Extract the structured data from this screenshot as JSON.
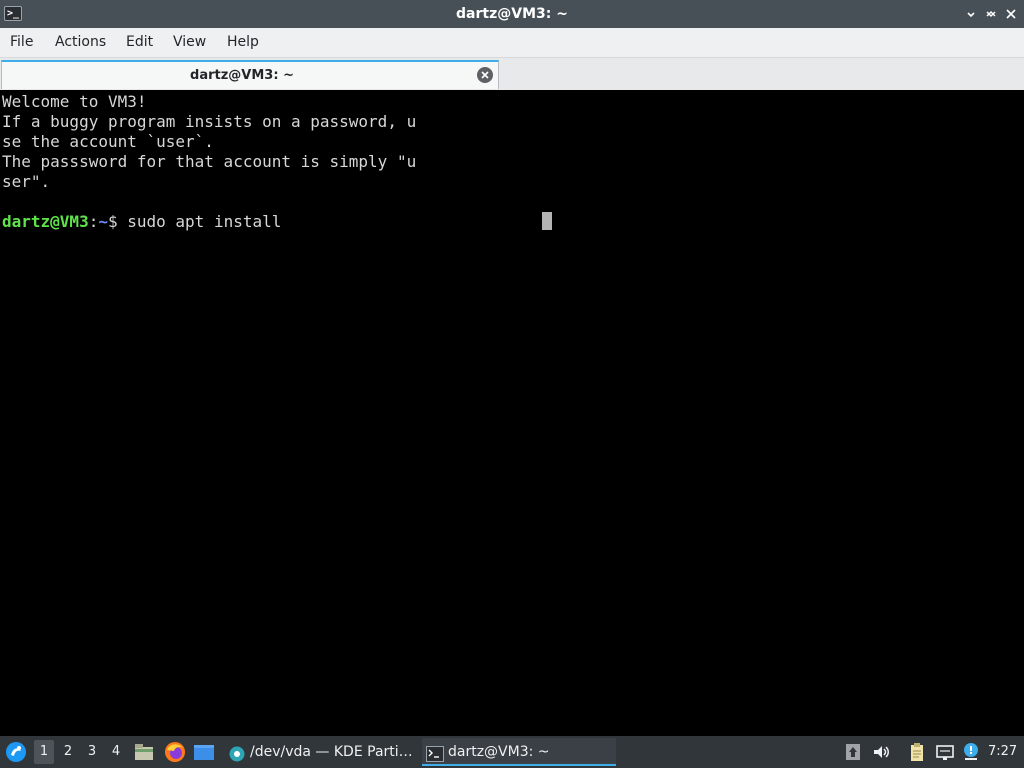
{
  "window": {
    "title": "dartz@VM3: ~",
    "app_icon": "terminal-icon",
    "controls": [
      "minimize-icon",
      "maximize-icon",
      "close-icon"
    ]
  },
  "menu": {
    "items": [
      "File",
      "Actions",
      "Edit",
      "View",
      "Help"
    ]
  },
  "tabs": [
    {
      "label": "dartz@VM3: ~",
      "active": true
    }
  ],
  "terminal": {
    "lines": [
      "Welcome to VM3!",
      "If a buggy program insists on a password, u",
      "se the account `user`.",
      "The passsword for that account is simply \"u",
      "ser\".",
      ""
    ],
    "prompt": {
      "user_host": "dartz@VM3",
      "separator": ":",
      "path": "~",
      "symbol": "$ ",
      "command": "sudo apt install"
    }
  },
  "taskbar": {
    "desktops": [
      "1",
      "2",
      "3",
      "4"
    ],
    "active_desktop": "1",
    "launchers": [
      "start-menu-icon",
      "file-manager-icon",
      "firefox-icon",
      "show-desktop-icon"
    ],
    "tasks": [
      {
        "label": "/dev/vda — KDE Parti…",
        "icon": "kde-partition-manager-icon"
      },
      {
        "label": "dartz@VM3: ~",
        "icon": "terminal-icon"
      }
    ],
    "tray": [
      "updates-icon",
      "volume-icon",
      "clipboard-icon",
      "network-icon",
      "notifications-icon"
    ],
    "clock": "7:27"
  },
  "colors": {
    "titlebar": "#475057",
    "menubar": "#eff0f1",
    "terminal_bg": "#000000",
    "terminal_fg": "#d7d7d7",
    "prompt_user": "#5fe34a",
    "prompt_path": "#6b8cff",
    "accent": "#3daee9",
    "taskbar": "#31363b"
  }
}
